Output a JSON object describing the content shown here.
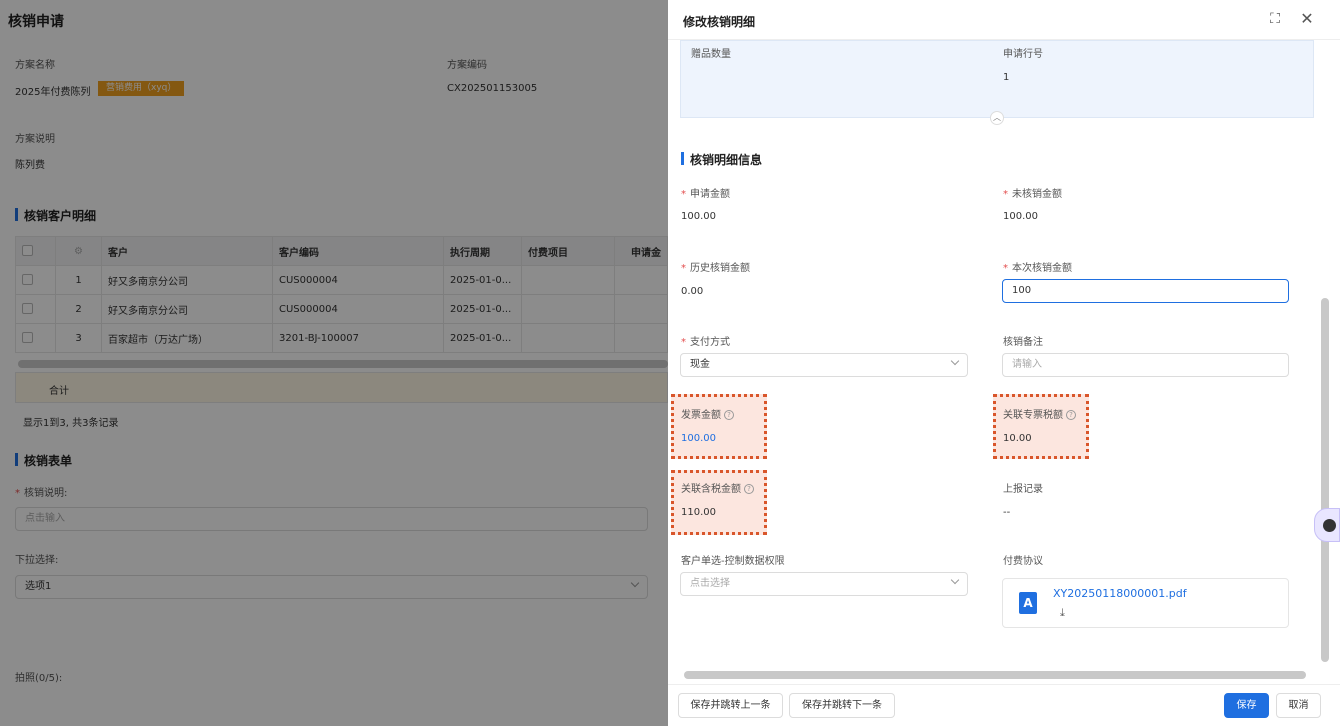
{
  "page": {
    "title": "核销申请"
  },
  "plan": {
    "name_label": "方案名称",
    "name_value": "2025年付费陈列",
    "tag": "营销费用（xyq）",
    "code_label": "方案编码",
    "code_value": "CX202501153005",
    "desc_label": "方案说明",
    "desc_value": "陈列费"
  },
  "customers": {
    "section_title": "核销客户明细",
    "headers": [
      "",
      "",
      "客户",
      "客户编码",
      "执行周期",
      "付费项目",
      "申请金"
    ],
    "rows": [
      {
        "no": "1",
        "customer": "好又多南京分公司",
        "code": "CUS000004",
        "period": "2025-01-0..."
      },
      {
        "no": "2",
        "customer": "好又多南京分公司",
        "code": "CUS000004",
        "period": "2025-01-0..."
      },
      {
        "no": "3",
        "customer": "百家超市（万达广场）",
        "code": "3201-BJ-100007",
        "period": "2025-01-0..."
      }
    ],
    "total_label": "合计",
    "record_info": "显示1到3, 共3条记录"
  },
  "form": {
    "section_title": "核销表单",
    "desc_label": "核销说明:",
    "desc_placeholder": "点击输入",
    "dropdown_label": "下拉选择:",
    "dropdown_value": "选项1",
    "photo_label": "拍照(0/5):"
  },
  "panel": {
    "title": "修改核销明细",
    "gift_qty_label": "赠品数量",
    "line_no_label": "申请行号",
    "line_no_value": "1",
    "section_title": "核销明细信息",
    "apply_amount_label": "申请金额",
    "apply_amount_value": "100.00",
    "unverified_label": "未核销金额",
    "unverified_value": "100.00",
    "history_label": "历史核销金额",
    "history_value": "0.00",
    "current_label": "本次核销金额",
    "current_value": "100",
    "pay_method_label": "支付方式",
    "pay_method_value": "现金",
    "remark_label": "核销备注",
    "remark_placeholder": "请输入",
    "invoice_label": "发票金额",
    "invoice_value": "100.00",
    "tax_label": "关联专票税额",
    "tax_value": "10.00",
    "tax_incl_label": "关联含税金额",
    "tax_incl_value": "110.00",
    "report_label": "上报记录",
    "report_value": "--",
    "customer_select_label": "客户单选-控制数据权限",
    "customer_select_placeholder": "点击选择",
    "agreement_label": "付费协议",
    "file_name": "XY20250118000001.pdf"
  },
  "footer": {
    "prev_label": "保存并跳转上一条",
    "next_label": "保存并跳转下一条",
    "save_label": "保存",
    "cancel_label": "取消"
  },
  "colors": {
    "accent": "#1f6fe0",
    "highlight": "#d9562b",
    "tag": "#f0a020"
  }
}
